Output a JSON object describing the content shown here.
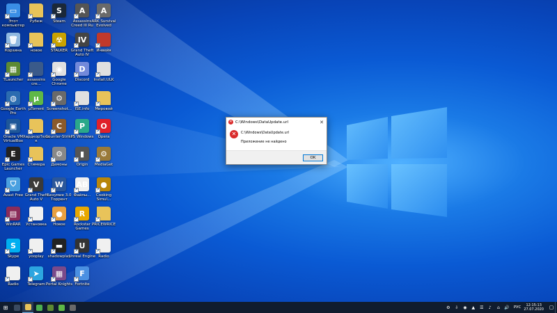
{
  "desktop": {
    "icons": [
      {
        "label": "Этот компьютер",
        "icon": "computer-icon",
        "color": "#3a8ee6",
        "glyph": "▭"
      },
      {
        "label": "Рубеж",
        "icon": "folder-icon",
        "color": "#e8c35a",
        "glyph": ""
      },
      {
        "label": "Steam",
        "icon": "steam-icon",
        "color": "#1b2838",
        "glyph": "S"
      },
      {
        "label": "Assassins Creed III Ru",
        "icon": "assassins-creed-icon",
        "color": "#555555",
        "glyph": "A"
      },
      {
        "label": "ARK Survival Evolved",
        "icon": "ark-icon",
        "color": "#6a6a6a",
        "glyph": "A"
      },
      {
        "label": "Корзина",
        "icon": "recycle-bin-icon",
        "color": "#8fb8e0",
        "glyph": "🗑"
      },
      {
        "label": "новое",
        "icon": "folder-icon",
        "color": "#e8c35a",
        "glyph": ""
      },
      {
        "label": "STALKER",
        "icon": "stalker-icon",
        "color": "#c9a200",
        "glyph": "☢"
      },
      {
        "label": "Grand Theft Auto IV",
        "icon": "gta-iv-icon",
        "color": "#444444",
        "glyph": "IV"
      },
      {
        "label": "Инвейя",
        "icon": "file-icon",
        "color": "#c0392b",
        "glyph": ""
      },
      {
        "label": "TLauncher",
        "icon": "minecraft-icon",
        "color": "#5d8a33",
        "glyph": "▦"
      },
      {
        "label": "assassins cre...",
        "icon": "file-icon",
        "color": "#3a5a8a",
        "glyph": ""
      },
      {
        "label": "Google Chrome",
        "icon": "chrome-icon",
        "color": "#e0e0e0",
        "glyph": "◉"
      },
      {
        "label": "Discord",
        "icon": "discord-icon",
        "color": "#7289da",
        "glyph": "D"
      },
      {
        "label": "Install.ULK",
        "icon": "file-icon",
        "color": "#e0e0e0",
        "glyph": ""
      },
      {
        "label": "Google Earth Pro",
        "icon": "google-earth-icon",
        "color": "#2b6cb0",
        "glyph": "◍"
      },
      {
        "label": "µTorrent",
        "icon": "utorrent-icon",
        "color": "#5fb846",
        "glyph": "µ"
      },
      {
        "label": "Screenshot...",
        "icon": "screenshot-icon",
        "color": "#6a6a6a",
        "glyph": "⚙"
      },
      {
        "label": "ISE.info",
        "icon": "file-icon",
        "color": "#e0e0e0",
        "glyph": ""
      },
      {
        "label": "Мировой",
        "icon": "folder-icon",
        "color": "#e8c35a",
        "glyph": ""
      },
      {
        "label": "Oracle VM VirtualBox",
        "icon": "virtualbox-icon",
        "color": "#1e5799",
        "glyph": "▣"
      },
      {
        "label": "ХардкорТелек",
        "icon": "folder-icon",
        "color": "#e8c35a",
        "glyph": ""
      },
      {
        "label": "Counter-Strike",
        "icon": "counter-strike-icon",
        "color": "#8a5a2b",
        "glyph": "C"
      },
      {
        "label": "PS Windows",
        "icon": "ps-icon",
        "color": "#2aa88a",
        "glyph": "P"
      },
      {
        "label": "Opera",
        "icon": "opera-icon",
        "color": "#e0202a",
        "glyph": "O"
      },
      {
        "label": "Epic Games Launcher",
        "icon": "epic-games-icon",
        "color": "#222222",
        "glyph": "E"
      },
      {
        "label": "Стимера",
        "icon": "folder-icon",
        "color": "#e8c35a",
        "glyph": ""
      },
      {
        "label": "Демоны",
        "icon": "settings-icon",
        "color": "#888888",
        "glyph": "⚙"
      },
      {
        "label": "Origin",
        "icon": "origin-icon",
        "color": "#555555",
        "glyph": "▮"
      },
      {
        "label": "MediaGet",
        "icon": "mediaget-icon",
        "color": "#9a7a3a",
        "glyph": "⚙"
      },
      {
        "label": "Avast Free",
        "icon": "antivirus-icon",
        "color": "#4aa0e0",
        "glyph": "⛉"
      },
      {
        "label": "Grand Theft Auto V",
        "icon": "gta-v-icon",
        "color": "#3a3a3a",
        "glyph": "V"
      },
      {
        "label": "Безумие 3.0 Торрент",
        "icon": "word-icon",
        "color": "#2b579a",
        "glyph": "W"
      },
      {
        "label": "Файлы...",
        "icon": "abc-icon",
        "color": "#f0f0f0",
        "glyph": "AB"
      },
      {
        "label": "Cooking Simul...",
        "icon": "game-icon",
        "color": "#b8860b",
        "glyph": "●"
      },
      {
        "label": "WinRAR",
        "icon": "winrar-icon",
        "color": "#8b2c5a",
        "glyph": "▤"
      },
      {
        "label": "Установка",
        "icon": "file-icon",
        "color": "#f0f0f0",
        "glyph": ""
      },
      {
        "label": "Новое",
        "icon": "file-icon",
        "color": "#e8a040",
        "glyph": "●"
      },
      {
        "label": "Rockstar Games",
        "icon": "rockstar-icon",
        "color": "#e8a800",
        "glyph": "R"
      },
      {
        "label": "PRICEWRICE",
        "icon": "folder-icon",
        "color": "#e8c35a",
        "glyph": ""
      },
      {
        "label": "Skype",
        "icon": "skype-icon",
        "color": "#00aff0",
        "glyph": "S"
      },
      {
        "label": "yooplay",
        "icon": "file-icon",
        "color": "#f0f0f0",
        "glyph": ""
      },
      {
        "label": "shadowplay",
        "icon": "file-icon",
        "color": "#222222",
        "glyph": "▬"
      },
      {
        "label": "Unreal Engine",
        "icon": "unreal-icon",
        "color": "#333333",
        "glyph": "U"
      },
      {
        "label": "Radio",
        "icon": "file-icon",
        "color": "#f0f0f0",
        "glyph": ""
      },
      {
        "label": "Radio",
        "icon": "file-icon",
        "color": "#f0f0f0",
        "glyph": ""
      },
      {
        "label": "Telegram",
        "icon": "telegram-icon",
        "color": "#2ca5e0",
        "glyph": "➤"
      },
      {
        "label": "Portal Knights",
        "icon": "game-icon",
        "color": "#7a4a8a",
        "glyph": "▦"
      },
      {
        "label": "Fortnite",
        "icon": "fortnite-icon",
        "color": "#4a90e2",
        "glyph": "F"
      }
    ]
  },
  "dialog": {
    "title": "C:\\Windows\\DataUpdate.url",
    "close_glyph": "✕",
    "line1": "C:\\Windows\\DataUpdate.url",
    "line2": "Приложение не найдено",
    "ok_label": "OK"
  },
  "taskbar": {
    "start_glyph": "⊞",
    "apps": [
      {
        "icon": "task-view-icon",
        "color": "#3a4a60"
      },
      {
        "icon": "file-explorer-icon",
        "color": "#e8c35a"
      },
      {
        "icon": "chrome-icon",
        "color": "#4caf50"
      },
      {
        "icon": "minecraft-icon",
        "color": "#5d8a33"
      },
      {
        "icon": "utorrent-icon",
        "color": "#5fb846"
      },
      {
        "icon": "app-icon",
        "color": "#6a6a6a"
      }
    ],
    "tray_glyphs": [
      "⚙",
      "⇩",
      "◉",
      "▲",
      "☰",
      "♪",
      "⌂",
      "🔊"
    ],
    "language": "РУС",
    "time": "12:15:13",
    "date": "27.07.2020",
    "notifications_glyph": "▢"
  }
}
